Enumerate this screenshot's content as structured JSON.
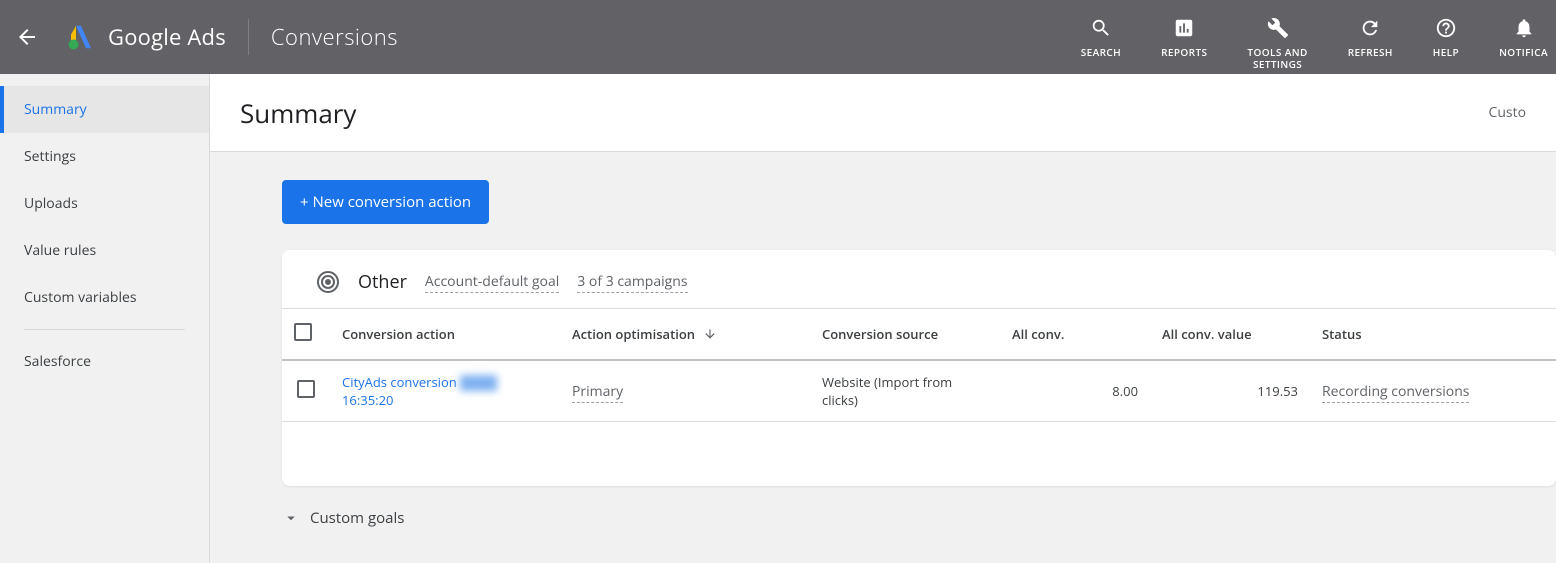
{
  "header": {
    "app_title": "Google Ads",
    "page_name": "Conversions",
    "tools": [
      {
        "label": "SEARCH",
        "icon": "search-icon"
      },
      {
        "label": "REPORTS",
        "icon": "reports-icon"
      },
      {
        "label": "TOOLS AND\nSETTINGS",
        "icon": "tools-icon"
      },
      {
        "label": "REFRESH",
        "icon": "refresh-icon"
      },
      {
        "label": "HELP",
        "icon": "help-icon"
      },
      {
        "label": "NOTIFICA",
        "icon": "notifications-icon"
      }
    ]
  },
  "sidebar": {
    "items": [
      {
        "label": "Summary",
        "active": true
      },
      {
        "label": "Settings"
      },
      {
        "label": "Uploads"
      },
      {
        "label": "Value rules"
      },
      {
        "label": "Custom variables"
      },
      {
        "label": "Salesforce"
      }
    ]
  },
  "content": {
    "title": "Summary",
    "top_right": "Custo",
    "new_action_label": "+ New conversion action",
    "card": {
      "title": "Other",
      "goal_label": "Account-default goal",
      "campaigns_label": "3 of 3 campaigns",
      "columns": {
        "conversion_action": "Conversion action",
        "action_optimisation": "Action optimisation",
        "conversion_source": "Conversion source",
        "all_conv": "All conv.",
        "all_conv_value": "All conv. value",
        "status": "Status"
      },
      "rows": [
        {
          "name_line1": "CityAds conversion",
          "name_blur": "████",
          "name_line2": "16:35:20",
          "optimisation": "Primary",
          "source": "Website (Import from clicks)",
          "all_conv": "8.00",
          "all_conv_value": "119.53",
          "status": "Recording conversions"
        }
      ]
    },
    "custom_goals_label": "Custom goals"
  }
}
